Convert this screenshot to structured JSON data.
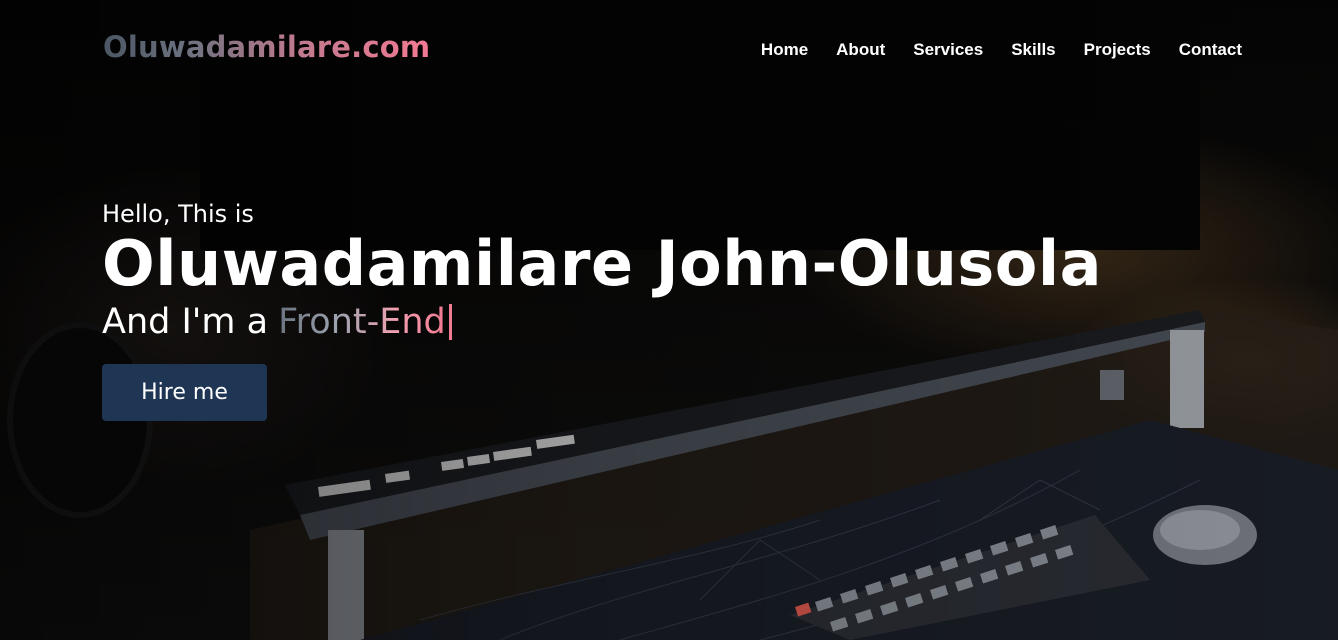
{
  "nav": {
    "logo": "Oluwadamilare.com",
    "links": [
      "Home",
      "About",
      "Services",
      "Skills",
      "Projects",
      "Contact"
    ]
  },
  "hero": {
    "greeting": "Hello, This is",
    "name": "Oluwadamilare John-Olusola",
    "role_prefix": "And I'm a",
    "role_typed": "Front-End",
    "cta_label": "Hire me"
  },
  "colors": {
    "button_bg": "#1e3553",
    "accent_pink": "#f27a93",
    "accent_gray": "#6b7280"
  }
}
